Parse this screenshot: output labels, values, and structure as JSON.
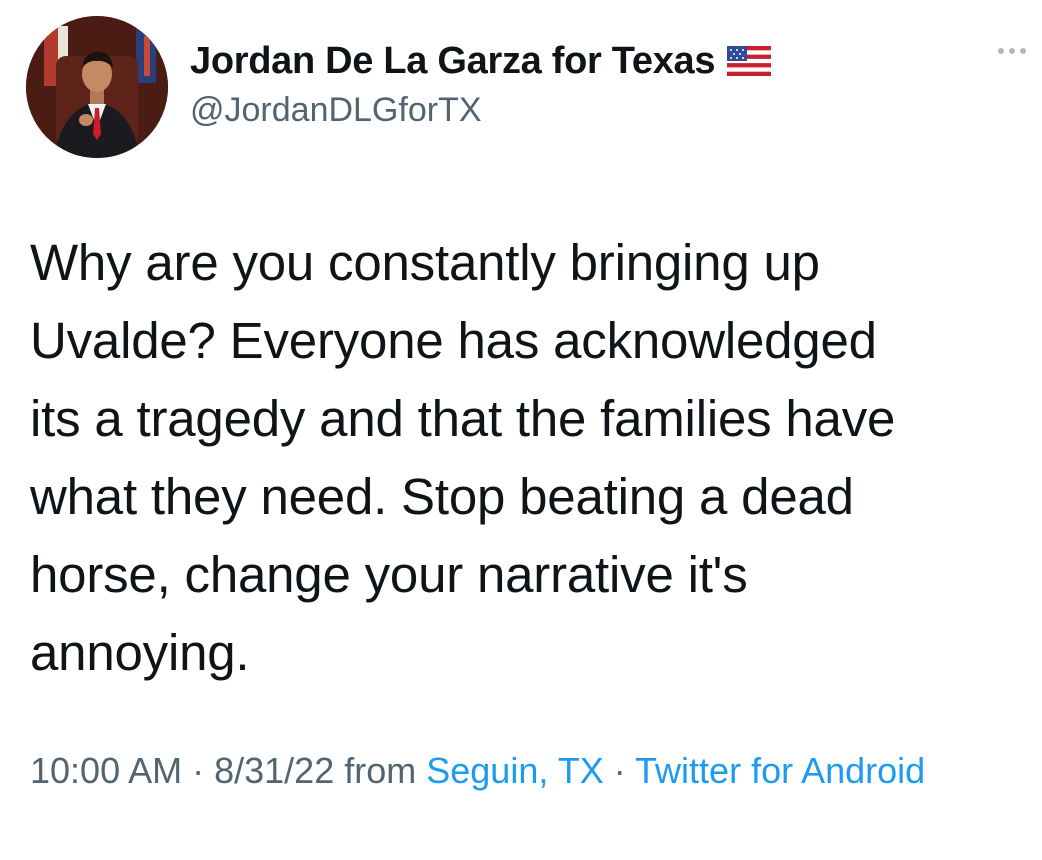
{
  "author": {
    "display_name": "Jordan De La Garza for Texas",
    "handle": "@JordanDLGforTX",
    "flag_icon": "us-flag-icon"
  },
  "tweet": {
    "text": "Why are you constantly bringing up\nUvalde? Everyone has acknowledged\nits a tragedy and that the families have\nwhat they need. Stop beating a dead\nhorse, change your narrative it's\nannoying."
  },
  "meta": {
    "time": "10:00 AM",
    "sep1": " · ",
    "date": "8/31/22",
    "from_label": " from ",
    "location": "Seguin, TX",
    "sep2": " · ",
    "client": "Twitter for Android"
  },
  "colors": {
    "text": "#0f1419",
    "secondary": "#536471",
    "link": "#1d9bf0"
  }
}
